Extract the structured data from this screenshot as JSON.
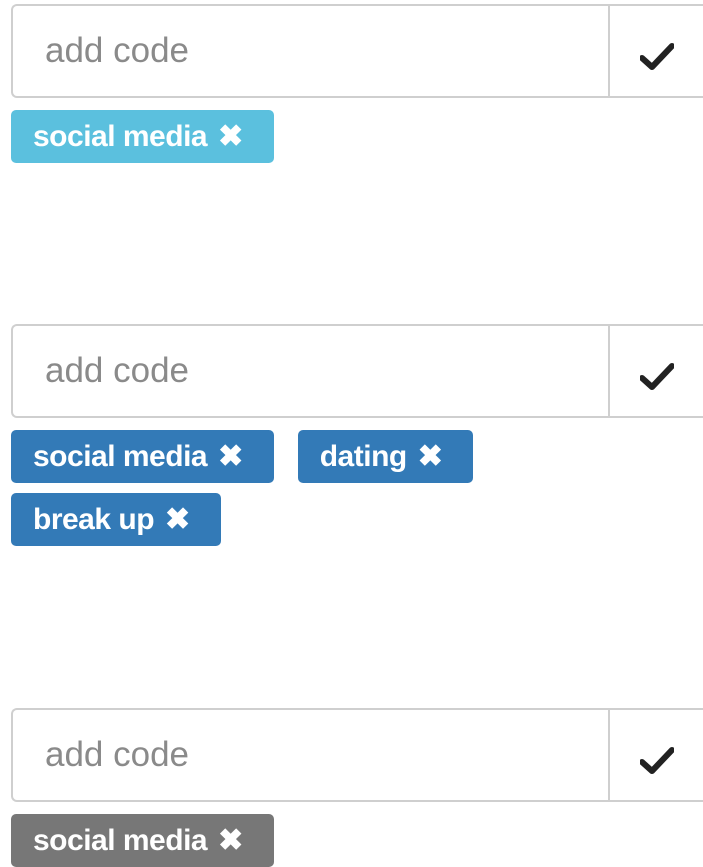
{
  "groups": [
    {
      "input": {
        "placeholder": "add code",
        "value": ""
      },
      "confirm_icon": "check-icon",
      "tag_color": "#5bc0de",
      "tags": [
        {
          "label": "social media",
          "remove": "✖"
        }
      ]
    },
    {
      "input": {
        "placeholder": "add code",
        "value": ""
      },
      "confirm_icon": "check-icon",
      "tag_color": "#337ab7",
      "tags": [
        {
          "label": "social media",
          "remove": "✖"
        },
        {
          "label": "dating",
          "remove": "✖"
        },
        {
          "label": "break up",
          "remove": "✖"
        }
      ]
    },
    {
      "input": {
        "placeholder": "add code",
        "value": ""
      },
      "confirm_icon": "check-icon",
      "tag_color": "#777777",
      "tags": [
        {
          "label": "social media",
          "remove": "✖"
        }
      ]
    }
  ]
}
